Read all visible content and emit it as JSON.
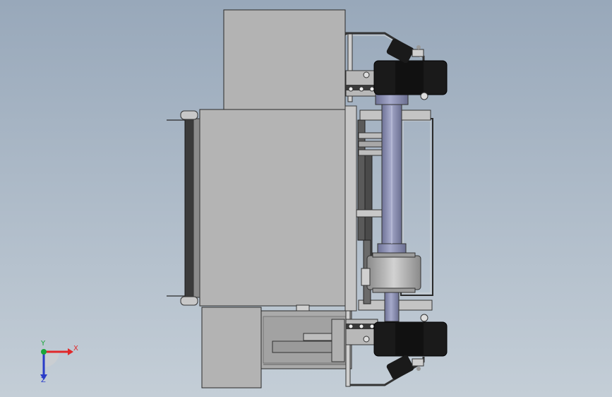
{
  "viewport": {
    "background_top": "#98a8ba",
    "background_bottom": "#c4ced7"
  },
  "triad": {
    "x_label": "X",
    "y_label": "Y",
    "z_label": "Z",
    "x_color": "#e0282a",
    "y_color": "#1aa63a",
    "z_color": "#2a3cc8"
  },
  "colors": {
    "housing": "#b4b4b4",
    "housing_edge": "#2a2a2a",
    "roller": "#1a1a1a",
    "shaft": "#8e92b4",
    "frame_metal": "#c8c8c8"
  }
}
